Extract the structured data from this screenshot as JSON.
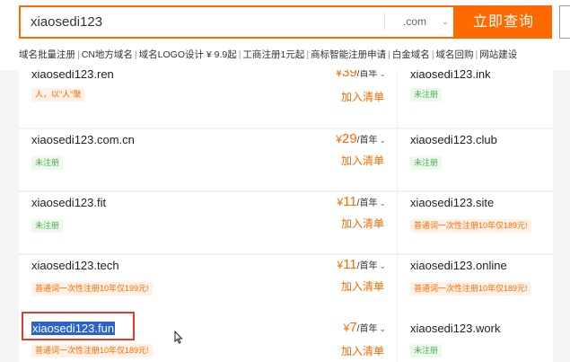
{
  "search": {
    "value": "xiaosedi123",
    "tld": ".com",
    "button_label": "立即查询"
  },
  "quicklinks": [
    "域名批量注册",
    "CN地方域名",
    "域名LOGO设计 ¥ 9.9起",
    "工商注册1元起",
    "商标智能注册申请",
    "白金域名",
    "域名回购",
    "网站建设"
  ],
  "rows": [
    {
      "left": {
        "name": "xiaosedi123.ren",
        "tag": "人，以\"人\"聚",
        "tag_style": "orange",
        "yen": "¥",
        "price": "39",
        "unit": "/首年",
        "add": "加入清单"
      },
      "right": {
        "name": "xiaosedi123.ink",
        "tag": "未注册",
        "tag_style": "green"
      }
    },
    {
      "left": {
        "name": "xiaosedi123.com.cn",
        "tag": "未注册",
        "tag_style": "green",
        "yen": "¥",
        "price": "29",
        "unit": "/首年",
        "add": "加入清单"
      },
      "right": {
        "name": "xiaosedi123.club",
        "tag": "未注册",
        "tag_style": "green"
      }
    },
    {
      "left": {
        "name": "xiaosedi123.fit",
        "tag": "未注册",
        "tag_style": "green",
        "yen": "¥",
        "price": "11",
        "unit": "/首年",
        "add": "加入清单"
      },
      "right": {
        "name": "xiaosedi123.site",
        "tag": "普通词一次性注册10年仅189元!",
        "tag_style": "orange"
      }
    },
    {
      "left": {
        "name": "xiaosedi123.tech",
        "tag": "普通词一次性注册10年仅199元!",
        "tag_style": "orange",
        "yen": "¥",
        "price": "11",
        "unit": "/首年",
        "add": "加入清单"
      },
      "right": {
        "name": "xiaosedi123.online",
        "tag": "普通词一次性注册10年仅189元!",
        "tag_style": "orange"
      }
    },
    {
      "left": {
        "name": "xiaosedi123.fun",
        "tag": "普通词一次性注册10年仅189元!",
        "tag_style": "orange",
        "yen": "¥",
        "price": "7",
        "unit": "/首年",
        "add": "加入清单"
      },
      "right": {
        "name": "xiaosedi123.work",
        "tag": "未注册",
        "tag_style": "green"
      }
    }
  ],
  "colors": {
    "accent": "#ff6a00",
    "registered_green": "#4caf50",
    "highlight_box": "#e43a2b"
  }
}
